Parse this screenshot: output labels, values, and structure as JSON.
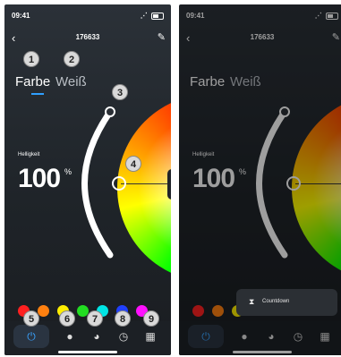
{
  "status": {
    "time_left": "09:41",
    "time_right": "09:41"
  },
  "header": {
    "back": "‹",
    "title": "176633",
    "edit": "✎"
  },
  "tabs": {
    "color": "Farbe",
    "white": "Weiß"
  },
  "brightness": {
    "label": "Helligkeit",
    "value": "100",
    "unit": "%"
  },
  "swatches": [
    "#ff2020",
    "#ff8010",
    "#ffee00",
    "#22dd22",
    "#00e5e5",
    "#2040ff",
    "#ff10ff"
  ],
  "tabbar": {
    "power": "⏻",
    "bulb": "●",
    "palette": "◕",
    "timer": "◷",
    "more": "▦"
  },
  "markers": [
    "1",
    "2",
    "3",
    "4",
    "5",
    "6",
    "7",
    "8",
    "9"
  ],
  "popup": {
    "icon": "⧗",
    "label": "Countdown"
  },
  "icons": {
    "wifi": "wifi-icon",
    "battery": "battery-icon",
    "location": "location-icon"
  },
  "colors": {
    "accent": "#2fa0ff",
    "background": "#1f2429"
  }
}
